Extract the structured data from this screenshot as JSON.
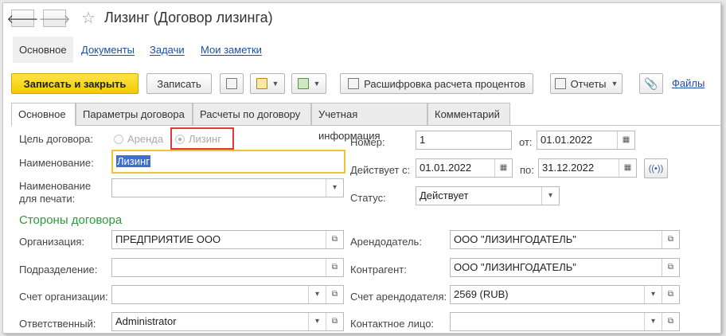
{
  "header": {
    "back_icon": "arrow-left-icon",
    "forward_icon": "arrow-right-icon",
    "title": "Лизинг (Договор лизинга)"
  },
  "command_tabs": [
    "Основное",
    "Документы",
    "Задачи",
    "Мои заметки"
  ],
  "toolbar": {
    "save_close": "Записать и закрыть",
    "save": "Записать",
    "interest_breakdown": "Расшифровка расчета процентов",
    "reports": "Отчеты",
    "files": "Файлы"
  },
  "form_tabs": [
    "Основное",
    "Параметры договора",
    "Расчеты по договору",
    "Учетная информация",
    "Комментарий"
  ],
  "form": {
    "purpose_label": "Цель договора:",
    "purpose_options": [
      "Аренда",
      "Лизинг"
    ],
    "purpose_selected": "Лизинг",
    "name_label": "Наименование:",
    "name_value": "Лизинг",
    "print_name_label_1": "Наименование",
    "print_name_label_2": "для печати:",
    "print_name_value": "",
    "number_label": "Номер:",
    "number_value": "1",
    "from_label": "от:",
    "from_value": "01.01.2022",
    "valid_label": "Действует с:",
    "valid_from": "01.01.2022",
    "to_label": "по:",
    "valid_to": "31.12.2022",
    "status_label": "Статус:",
    "status_value": "Действует"
  },
  "parties": {
    "section_title": "Стороны договора",
    "org_label": "Организация:",
    "org_value": "ПРЕДПРИЯТИЕ ООО",
    "dept_label": "Подразделение:",
    "dept_value": "",
    "org_account_label": "Счет организации:",
    "org_account_value": "",
    "responsible_label": "Ответственный:",
    "responsible_value": "Administrator",
    "lessor_label": "Арендодатель:",
    "lessor_value": "ООО \"ЛИЗИНГОДАТЕЛЬ\"",
    "counterparty_label": "Контрагент:",
    "counterparty_value": "ООО \"ЛИЗИНГОДАТЕЛЬ\"",
    "lessor_account_label": "Счет арендодателя:",
    "lessor_account_value": "2569 (RUB)",
    "contact_label": "Контактное лицо:",
    "contact_value": ""
  }
}
